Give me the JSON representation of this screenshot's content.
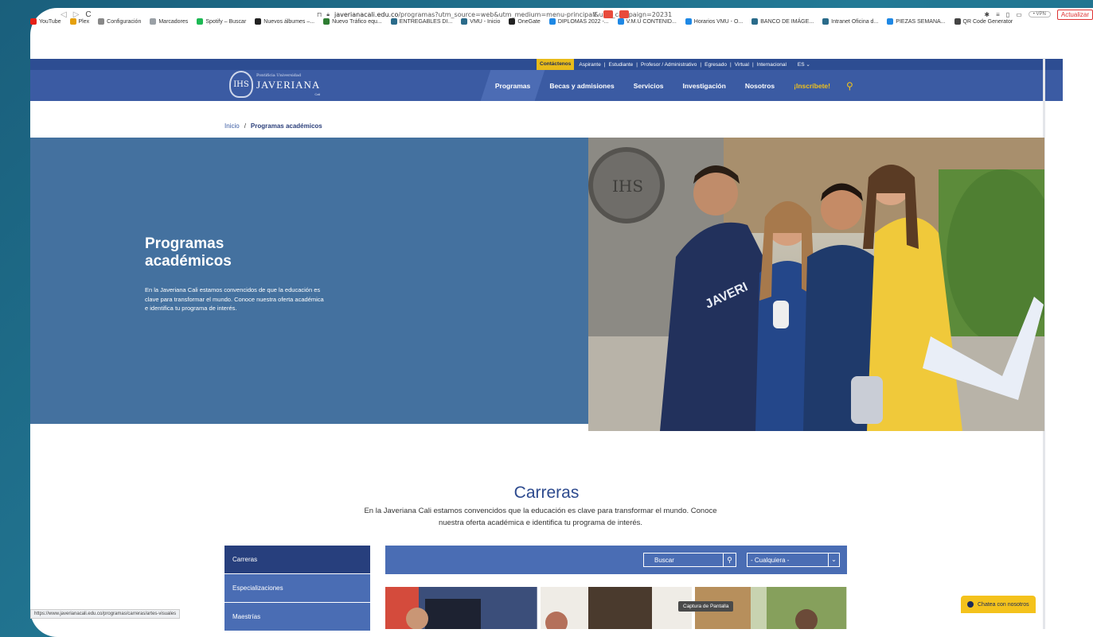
{
  "browser": {
    "url_domain": "javerianacali.edu.co",
    "url_path": "/programas?utm_source=web&utm_medium=menu-principal&utm_campaign=20231",
    "vpn": "• VPN",
    "update": "Actualizar"
  },
  "bookmarks": [
    {
      "label": "YouTube",
      "color": "#e62117"
    },
    {
      "label": "Plex",
      "color": "#e5a00d"
    },
    {
      "label": "Configuración",
      "color": "#888888"
    },
    {
      "label": "Marcadores",
      "color": "#9aa0a6"
    },
    {
      "label": "Spotify – Buscar",
      "color": "#1db954"
    },
    {
      "label": "Nuevos álbumes –...",
      "color": "#222222"
    },
    {
      "label": "Nuevo Tráfico equ...",
      "color": "#2e7d32"
    },
    {
      "label": "ENTREGABLES DI...",
      "color": "#2a6b8a"
    },
    {
      "label": "VMU - Inicio",
      "color": "#2a6b8a"
    },
    {
      "label": "OneGate",
      "color": "#222222"
    },
    {
      "label": "DIPLOMAS 2022 -...",
      "color": "#1e88e5"
    },
    {
      "label": "V.M.U CONTENID...",
      "color": "#1e88e5"
    },
    {
      "label": "Horarios VMU - O...",
      "color": "#1e88e5"
    },
    {
      "label": "BANCO DE IMÁGE...",
      "color": "#2a6b8a"
    },
    {
      "label": "Intranet Oficina d...",
      "color": "#2a6b8a"
    },
    {
      "label": "PIEZAS SEMANA...",
      "color": "#1e88e5"
    },
    {
      "label": "QR Code Generator",
      "color": "#444444"
    }
  ],
  "utility_nav": {
    "contact": "Contáctenos",
    "items": [
      "Aspirante",
      "Estudiante",
      "Profesor / Administrativo",
      "Egresado",
      "Virtual",
      "Internacional"
    ],
    "lang": "ES ⌄"
  },
  "logo": {
    "seal": "IHS",
    "line1": "Pontificia Universidad",
    "line2": "JAVERIANA",
    "line3": "Cali"
  },
  "main_nav": {
    "items": [
      "Programas",
      "Becas y admisiones",
      "Servicios",
      "Investigación",
      "Nosotros",
      "¡Inscríbete!"
    ]
  },
  "breadcrumb": {
    "home": "Inicio",
    "separator": "/",
    "current": "Programas académicos"
  },
  "hero": {
    "title": "Programas académicos",
    "description": "En la Javeriana Cali estamos convencidos de que la educación es clave para transformar el mundo. Conoce nuestra oferta académica e identifica tu programa de interés."
  },
  "carreras": {
    "title": "Carreras",
    "description": "En la Javeriana Cali estamos convencidos que la educación es clave para transformar el mundo. Conoce nuestra oferta académica e identifica tu programa de interés.",
    "tabs": [
      "Carreras",
      "Especializaciones",
      "Maestrías"
    ],
    "search_placeholder": "Buscar",
    "select_value": "- Cualquiera -"
  },
  "status_url": "https://www.javerianacali.edu.co/programas/carreras/artes-visuales",
  "tooltip": "Captura de Pantalla",
  "chat": "Chatea con nosotros",
  "colors": {
    "nav_blue": "#3b5ba3",
    "hero_blue": "#44719f",
    "accent_yellow": "#f1c21b"
  }
}
